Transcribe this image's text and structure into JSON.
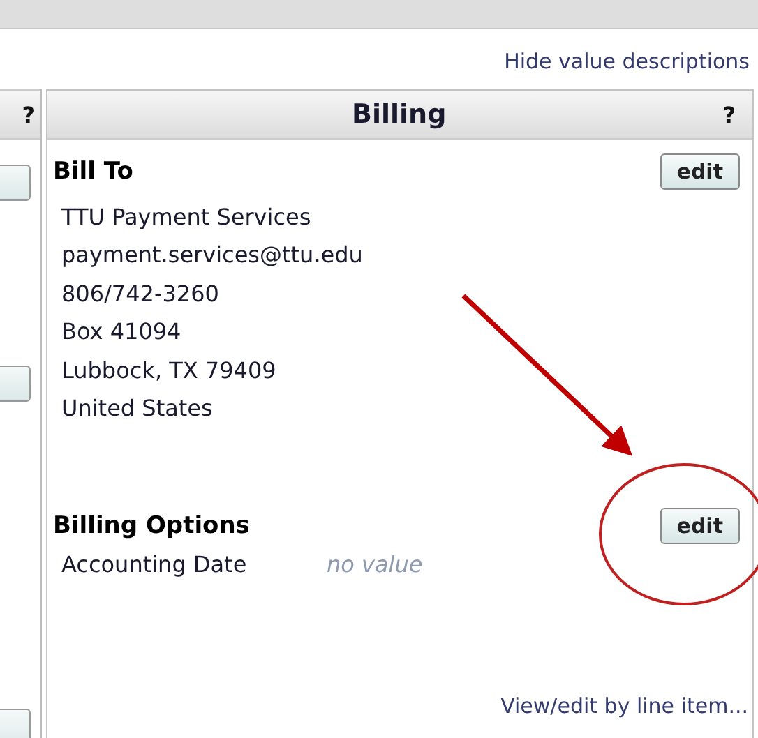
{
  "top_link": "Hide value descriptions",
  "left_panel": {
    "help": "?"
  },
  "billing": {
    "title": "Billing",
    "help": "?",
    "bill_to": {
      "heading": "Bill To",
      "button": "edit",
      "lines": [
        "TTU Payment Services",
        "payment.services@ttu.edu",
        "806/742-3260",
        "Box 41094",
        "Lubbock, TX 79409",
        "United States"
      ]
    },
    "options": {
      "heading": "Billing Options",
      "button": "edit",
      "fields": [
        {
          "label": "Accounting Date",
          "value": "no value",
          "empty": true
        }
      ]
    },
    "footer_link": "View/edit by line item..."
  }
}
